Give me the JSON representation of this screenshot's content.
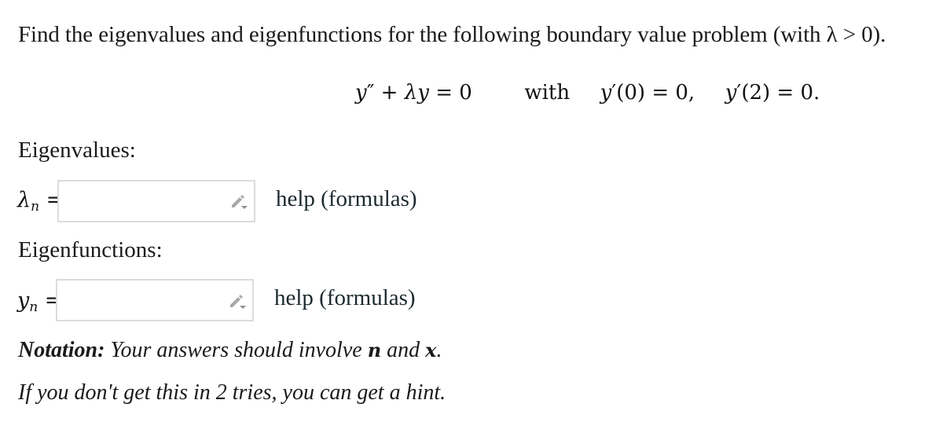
{
  "prompt": {
    "text": "Find the eigenvalues and eigenfunctions for the following boundary value problem (with λ > 0)."
  },
  "equation": {
    "ode_y": "y",
    "ode_prime": "″",
    "ode_plus": " + ",
    "ode_lambda": "λ",
    "ode_y2": "y",
    "ode_rhs": " = 0",
    "with_label": "with",
    "bc1_y": "y",
    "bc1_rest": "′(0) = 0,",
    "bc2_y": "y",
    "bc2_rest": "′(2) = 0."
  },
  "eigenvalues": {
    "section_label": "Eigenvalues:",
    "lhs_symbol": "λ",
    "lhs_subscript": "n",
    "lhs_equals": " =",
    "input_value": "",
    "input_placeholder": "",
    "help_link": "help (formulas)",
    "icon": "pencil-dropdown-icon"
  },
  "eigenfunctions": {
    "section_label": "Eigenfunctions:",
    "lhs_symbol": "y",
    "lhs_subscript": "n",
    "lhs_equals": " =",
    "input_value": "",
    "input_placeholder": "",
    "help_link": "help (formulas)",
    "icon": "pencil-dropdown-icon"
  },
  "notation": {
    "label": "Notation:",
    "text_before": " Your answers should involve ",
    "var1": "n",
    "text_mid": " and ",
    "var2": "x",
    "text_after": "."
  },
  "hint": {
    "text": "If you don't get this in 2 tries, you can get a hint."
  },
  "colors": {
    "input_border": "#dcdcdc",
    "icon_gray": "#9a9a9a",
    "link_text": "#1c2a2e"
  }
}
